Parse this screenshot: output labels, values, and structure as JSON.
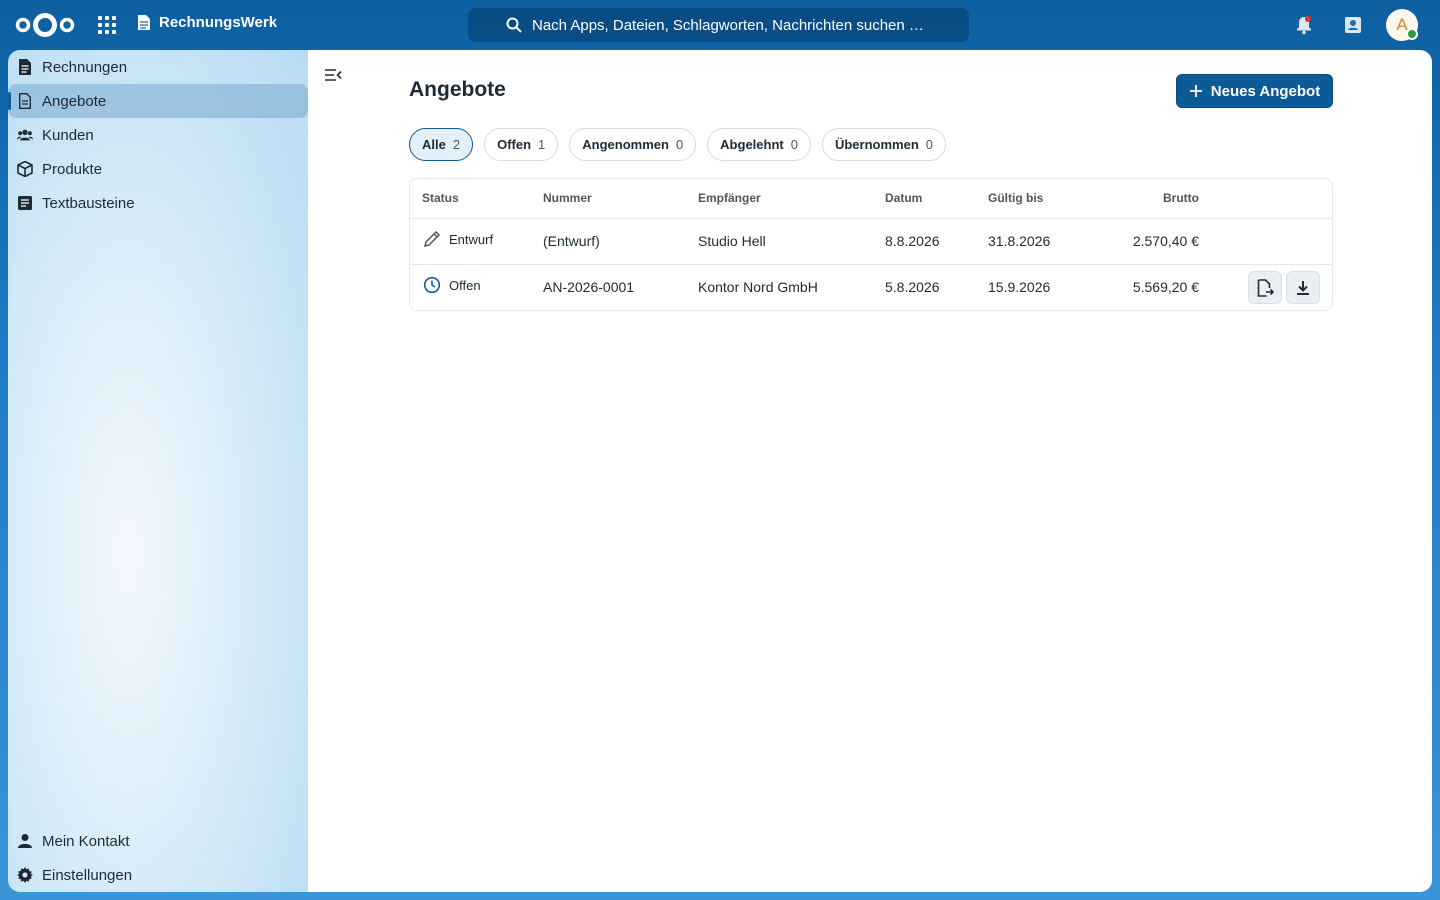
{
  "header": {
    "app_name": "RechnungsWerk",
    "search_placeholder": "Nach Apps, Dateien, Schlagworten, Nachrichten suchen …",
    "avatar_initial": "A"
  },
  "sidebar": {
    "items": [
      {
        "label": "Rechnungen",
        "icon": "document-icon"
      },
      {
        "label": "Angebote",
        "icon": "document-outline-icon",
        "active": true
      },
      {
        "label": "Kunden",
        "icon": "users-icon"
      },
      {
        "label": "Produkte",
        "icon": "box-icon"
      },
      {
        "label": "Textbausteine",
        "icon": "text-block-icon"
      }
    ],
    "bottom_items": [
      {
        "label": "Mein Kontakt",
        "icon": "user-icon"
      },
      {
        "label": "Einstellungen",
        "icon": "gear-icon"
      }
    ]
  },
  "main": {
    "title": "Angebote",
    "new_button": "Neues Angebot",
    "filters": [
      {
        "label": "Alle",
        "count": "2",
        "active": true
      },
      {
        "label": "Offen",
        "count": "1"
      },
      {
        "label": "Angenommen",
        "count": "0"
      },
      {
        "label": "Abgelehnt",
        "count": "0"
      },
      {
        "label": "Übernommen",
        "count": "0"
      }
    ],
    "table": {
      "columns": [
        "Status",
        "Nummer",
        "Empfänger",
        "Datum",
        "Gültig bis",
        "Brutto"
      ],
      "rows": [
        {
          "status": "Entwurf",
          "number": "(Entwurf)",
          "recipient": "Studio Hell",
          "date": "8.8.2026",
          "valid_until": "31.8.2026",
          "gross": "2.570,40 €"
        },
        {
          "status": "Offen",
          "number": "AN-2026-0001",
          "recipient": "Kontor Nord GmbH",
          "date": "5.8.2026",
          "valid_until": "15.9.2026",
          "gross": "5.569,20 €"
        }
      ]
    }
  },
  "colors": {
    "primary": "#0c5a96",
    "header_bg": "#0d5fa0",
    "notification_dot": "#e9322d",
    "online_status": "#2d9e3f"
  }
}
